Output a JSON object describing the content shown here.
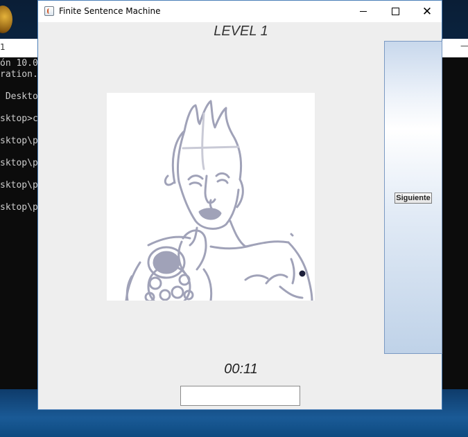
{
  "background": {
    "console_title_fragment": "1",
    "console_lines": [
      "ón 10.0",
      "ration.",
      "",
      " Deskto",
      "",
      "sktop>c",
      "",
      "sktop\\p",
      "",
      "sktop\\p",
      "",
      "sktop\\p",
      "",
      "sktop\\p"
    ]
  },
  "window": {
    "title": "Finite Sentence Machine",
    "icon": "java-cup-icon"
  },
  "game": {
    "level": "LEVEL 1",
    "timer": "00:11",
    "next_button": "Siguiente",
    "answer_value": "",
    "image_description_icon": "sketch-image"
  },
  "colors": {
    "sketch_stroke": "#a0a2b8",
    "panel_blue": "#bfd2e8",
    "window_border": "#4a7fb8"
  }
}
